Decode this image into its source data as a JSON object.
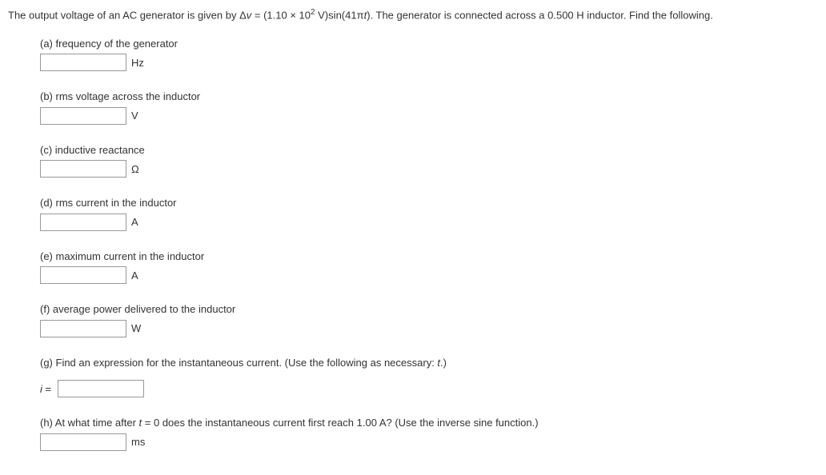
{
  "stem": {
    "prefix": "The output voltage of an AC generator is given by Δ",
    "varV": "v",
    "midA": " = (1.10 × 10",
    "sup": "2",
    "midB": " V)sin(41π",
    "varT": "t",
    "suffix": "). The generator is connected across a 0.500 H inductor. Find the following."
  },
  "parts": {
    "a": {
      "label": "(a) frequency of the generator",
      "unit": "Hz"
    },
    "b": {
      "label": "(b) rms voltage across the inductor",
      "unit": "V"
    },
    "c": {
      "label": "(c) inductive reactance",
      "unit": "Ω"
    },
    "d": {
      "label": "(d) rms current in the inductor",
      "unit": "A"
    },
    "e": {
      "label": "(e) maximum current in the inductor",
      "unit": "A"
    },
    "f": {
      "label": "(f) average power delivered to the inductor",
      "unit": "W"
    },
    "g": {
      "label_pre": "(g) Find an expression for the instantaneous current. (Use the following as necessary: ",
      "var": "t",
      "label_post": ".)",
      "lhs_i": "i",
      "lhs_eq": " ="
    },
    "h": {
      "label_pre": "(h) At what time after ",
      "var": "t",
      "label_post": " = 0 does the instantaneous current first reach 1.00 A? (Use the inverse sine function.)",
      "unit": "ms"
    }
  }
}
